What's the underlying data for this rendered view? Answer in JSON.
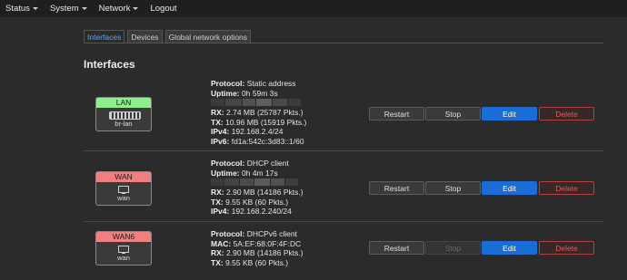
{
  "nav": {
    "status": "Status",
    "system": "System",
    "network": "Network",
    "logout": "Logout"
  },
  "tabs": [
    "Interfaces",
    "Devices",
    "Global network options"
  ],
  "heading": "Interfaces",
  "labels": {
    "protocol": "Protocol:",
    "uptime": "Uptime:",
    "rx": "RX:",
    "tx": "TX:",
    "ipv4": "IPv4:",
    "ipv6": "IPv6:",
    "mac": "MAC:"
  },
  "buttons": {
    "restart": "Restart",
    "stop": "Stop",
    "edit": "Edit",
    "delete": "Delete"
  },
  "interfaces": [
    {
      "name": "LAN",
      "device": "br-lan",
      "badge_color": "#90ee90",
      "protocol": "Static address",
      "uptime": "0h 59m 3s",
      "rx": "2.74 MB (25787 Pkts.)",
      "tx": "10.96 MB (15919 Pkts.)",
      "ipv4": "192.168.2.4/24",
      "ipv6": "fd1a:542c:3d83::1/60"
    },
    {
      "name": "WAN",
      "device": "wan",
      "badge_color": "#f08080",
      "protocol": "DHCP client",
      "uptime": "0h 4m 17s",
      "rx": "2.90 MB (14186 Pkts.)",
      "tx": "9.55 KB (60 Pkts.)",
      "ipv4": "192.168.2.240/24"
    },
    {
      "name": "WAN6",
      "device": "wan",
      "badge_color": "#f08080",
      "protocol": "DHCPv6 client",
      "mac": "5A:EF:68:0F:4F:DC",
      "rx": "2.90 MB (14186 Pkts.)",
      "tx": "9.55 KB (60 Pkts.)"
    }
  ]
}
